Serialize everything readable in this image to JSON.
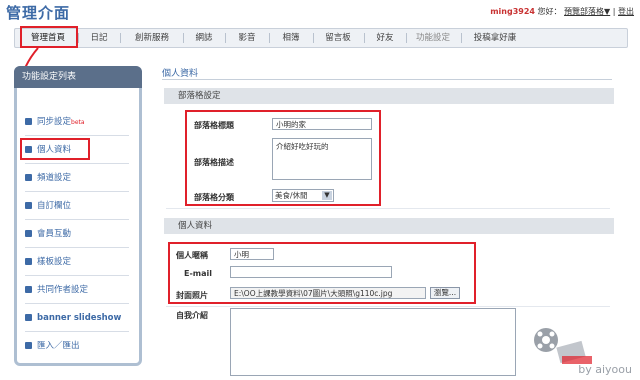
{
  "header": {
    "title": "管理介面",
    "username": "ming3924",
    "greeting": "您好：",
    "preview_link": "預覽部落格▼",
    "logout": "登出"
  },
  "nav": {
    "tabs": [
      "管理首頁",
      "日記",
      "創新服務",
      "網誌",
      "影音",
      "相簿",
      "留言板",
      "好友",
      "功能設定",
      "投稿拿好康"
    ],
    "active_index": 0,
    "disabled_index": 8
  },
  "sidebar": {
    "title": "功能設定列表",
    "items": [
      {
        "label": "同步設定",
        "badge": "beta"
      },
      {
        "label": "個人資料",
        "badge": ""
      },
      {
        "label": "頻道設定",
        "badge": ""
      },
      {
        "label": "自訂欄位",
        "badge": ""
      },
      {
        "label": "會員互動",
        "badge": ""
      },
      {
        "label": "樣板設定",
        "badge": ""
      },
      {
        "label": "共同作者設定",
        "badge": ""
      },
      {
        "label": "banner slideshow",
        "badge": ""
      },
      {
        "label": "匯入／匯出",
        "badge": ""
      }
    ]
  },
  "main": {
    "title": "個人資料",
    "blog_section": {
      "heading": "部落格設定",
      "title_label": "部落格標題",
      "title_value": "小明的家",
      "desc_label": "部落格描述",
      "desc_value": "介紹好吃好玩的",
      "category_label": "部落格分類",
      "category_value": "美食/休閒"
    },
    "profile_section": {
      "heading": "個人資料",
      "nickname_label": "個人暱稱",
      "nickname_value": "小明",
      "email_label": "E-mail",
      "email_value": "",
      "cover_label": "封面照片",
      "cover_value": "E:\\OO上課教學資料\\07圖片\\大頭照\\g110c.jpg",
      "browse_button": "瀏覽...",
      "intro_label": "自我介紹"
    }
  },
  "watermark": "by aiyoou",
  "colors": {
    "accent": "#3d6aa6",
    "highlight": "#e0202a",
    "sidebar_header": "#5b6f8a"
  }
}
